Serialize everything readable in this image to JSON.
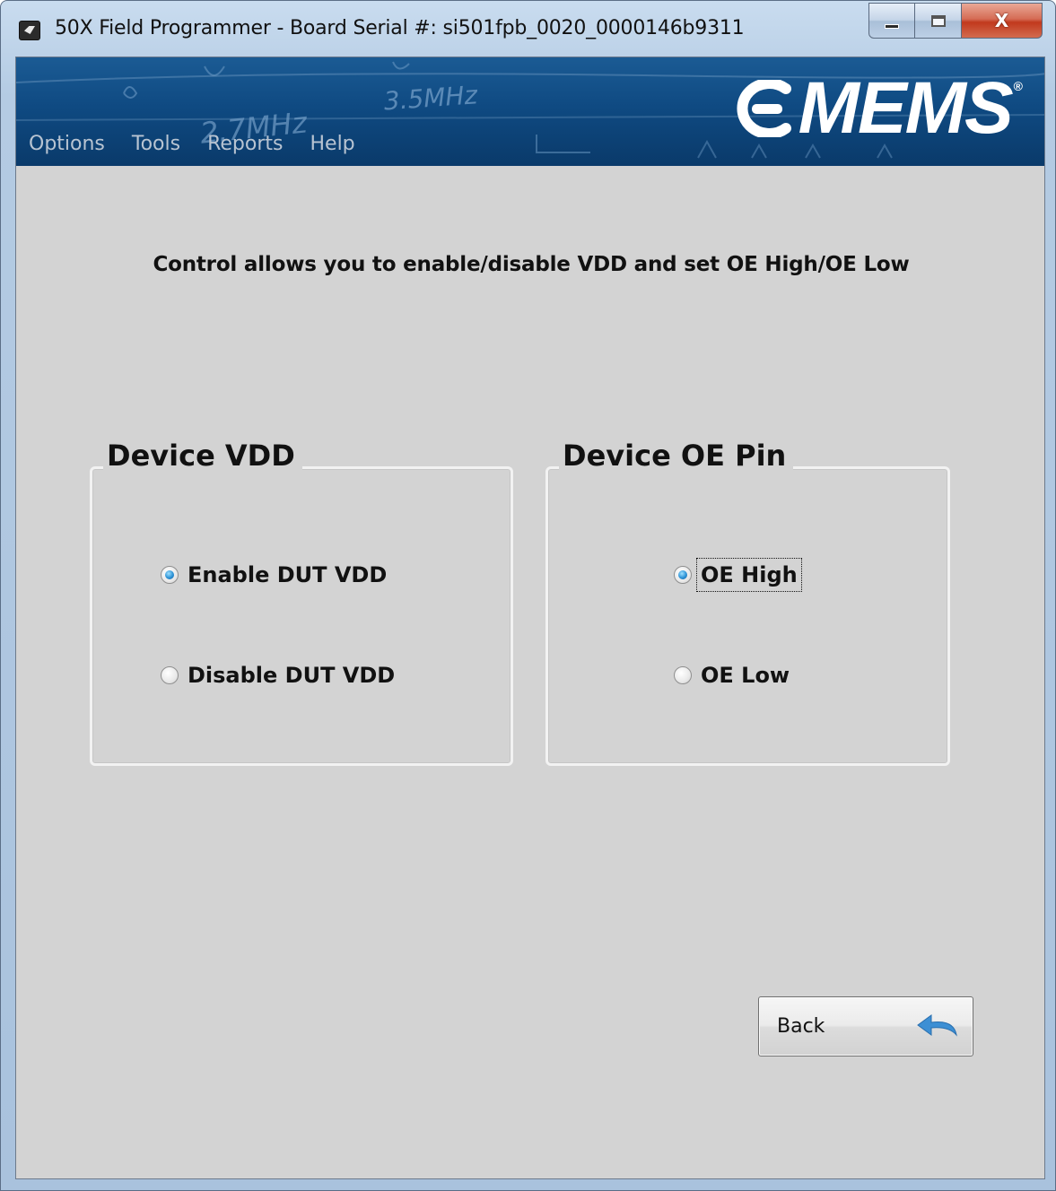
{
  "window": {
    "title": "50X Field Programmer - Board Serial #: si501fpb_0020_0000146b9311",
    "minimize_icon": "minimize-icon",
    "maximize_icon": "maximize-icon",
    "close_glyph": "X"
  },
  "menu": {
    "items": [
      {
        "label": "Options"
      },
      {
        "label": "Tools"
      },
      {
        "label": "Reports"
      },
      {
        "label": "Help"
      }
    ]
  },
  "banner": {
    "logo_text": "MEMS",
    "logo_reg": "®",
    "handwriting": [
      "3.5MHz",
      "2.7MHz"
    ]
  },
  "main": {
    "instruction": "Control allows you to enable/disable VDD and set OE High/OE Low",
    "vdd_group": {
      "title": "Device VDD",
      "options": [
        {
          "label": "Enable DUT VDD",
          "checked": true
        },
        {
          "label": "Disable DUT VDD",
          "checked": false
        }
      ]
    },
    "oe_group": {
      "title": "Device OE Pin",
      "options": [
        {
          "label": "OE High",
          "checked": true,
          "focused": true
        },
        {
          "label": "OE Low",
          "checked": false
        }
      ]
    },
    "back_button": {
      "label": "Back",
      "icon": "back-arrow-icon"
    }
  },
  "colors": {
    "client_bg": "#d3d3d3",
    "banner_blue": "#0f4a82",
    "radio_accent": "#2c92d6",
    "close_red": "#c1391d"
  }
}
